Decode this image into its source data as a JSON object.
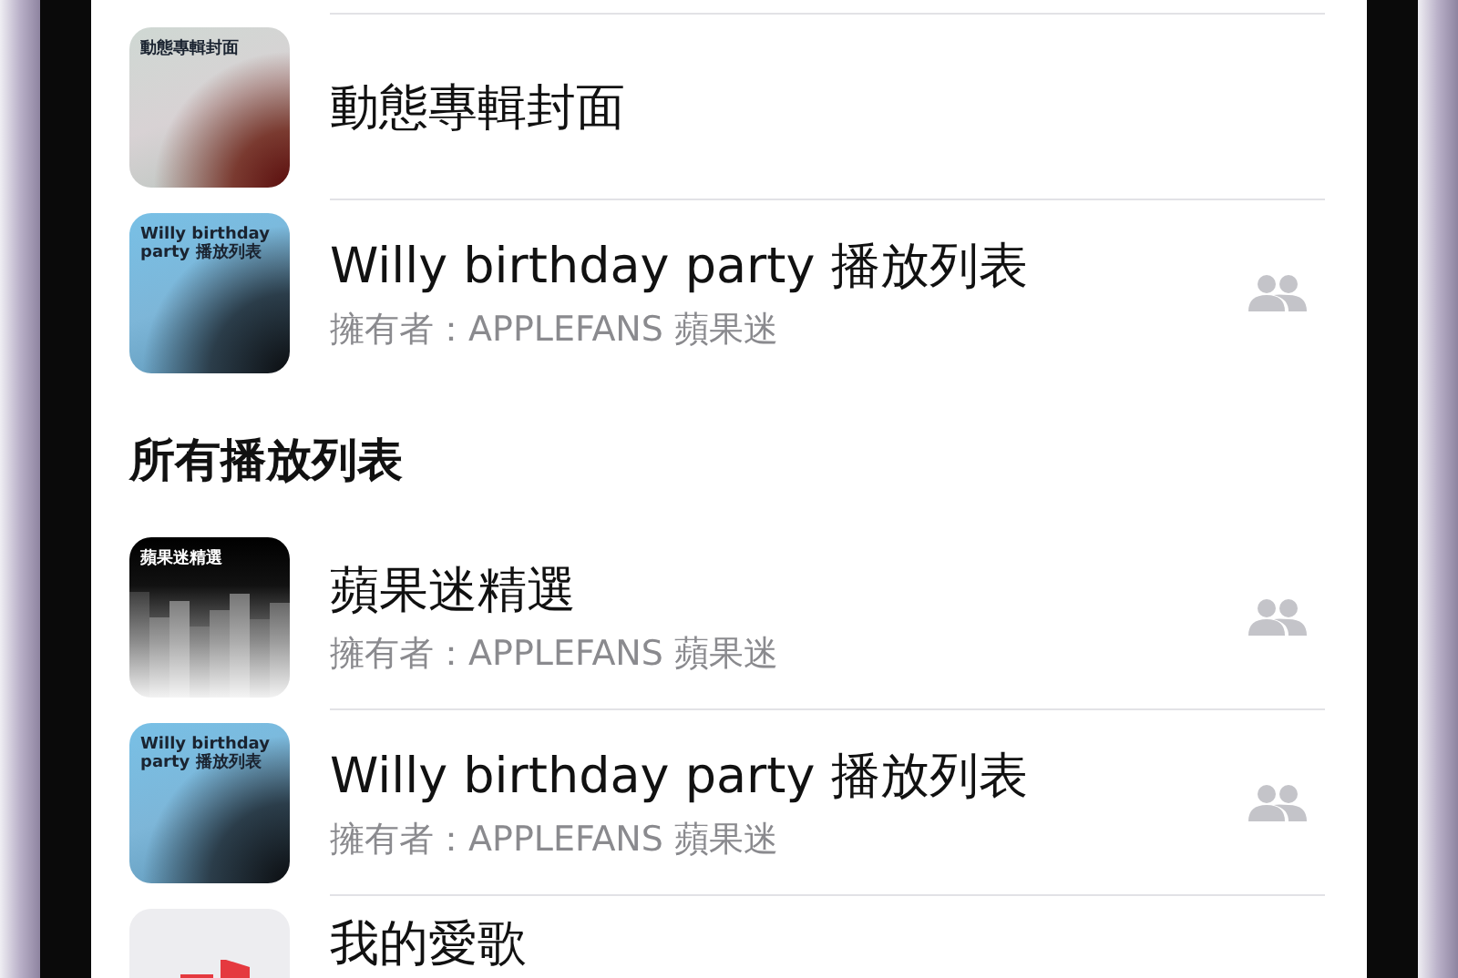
{
  "sections": [
    {
      "items": [
        {
          "title": "動態專輯封面",
          "shared": false,
          "artwork": {
            "kind": "dynamic",
            "label": "動態專輯封面"
          }
        },
        {
          "title": "Willy birthday party 播放列表",
          "owner": "擁有者：APPLEFANS 蘋果迷",
          "shared": true,
          "artwork": {
            "kind": "blue",
            "label": "Willy birthday party 播放列表"
          }
        }
      ]
    },
    {
      "heading": "所有播放列表",
      "items": [
        {
          "title": "蘋果迷精選",
          "owner": "擁有者：APPLEFANS 蘋果迷",
          "shared": true,
          "artwork": {
            "kind": "bars",
            "label": "蘋果迷精選"
          }
        },
        {
          "title": "Willy birthday party 播放列表",
          "owner": "擁有者：APPLEFANS 蘋果迷",
          "shared": true,
          "artwork": {
            "kind": "blue",
            "label": "Willy birthday party 播放列表"
          }
        },
        {
          "title": "我的愛歌",
          "shared": false,
          "artwork": {
            "kind": "favorites"
          }
        }
      ]
    }
  ]
}
